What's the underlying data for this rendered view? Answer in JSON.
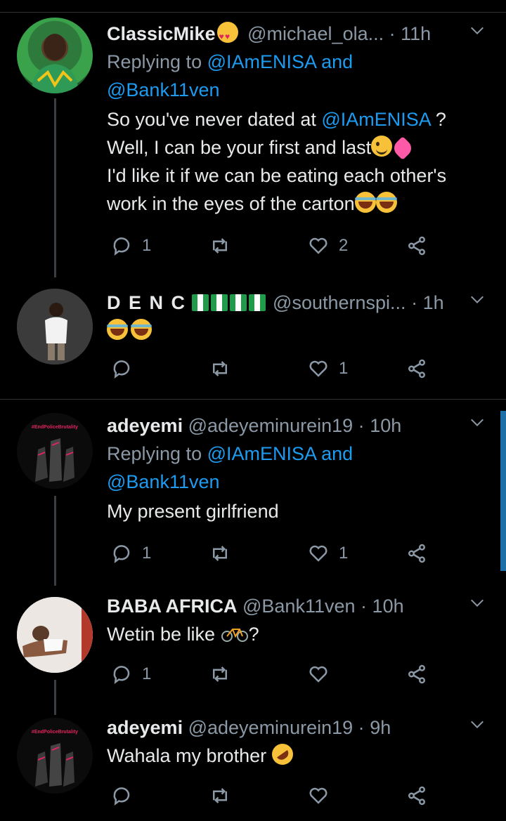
{
  "tweets": [
    {
      "name": "ClassicMike",
      "handle": "@michael_ola...",
      "time": "11h",
      "reply_prefix": "Replying to",
      "reply_users": [
        "@IAmENISA",
        "@Bank11ven"
      ],
      "reply_and": "and",
      "lines": [
        {
          "pre": "So you've never dated at ",
          "mention": "@IAmENISA",
          "post": " ?"
        },
        {
          "pre": "Well, I can be your first and last",
          "mention": "",
          "post": ""
        },
        {
          "pre": "I'd like it if we can be eating each other's",
          "mention": "",
          "post": ""
        },
        {
          "pre": "work in the eyes of the carton",
          "mention": "",
          "post": ""
        }
      ],
      "reply_count": "1",
      "retweet_count": "",
      "like_count": "2"
    },
    {
      "name": "D E N C",
      "handle": "@southernspi...",
      "time": "1h",
      "text": "",
      "reply_count": "",
      "retweet_count": "",
      "like_count": "1"
    },
    {
      "name": "adeyemi",
      "handle": "@adeyeminurein19",
      "time": "10h",
      "reply_prefix": "Replying to",
      "reply_users": [
        "@IAmENISA",
        "@Bank11ven"
      ],
      "reply_and": "and",
      "text": "My present girlfriend",
      "reply_count": "1",
      "retweet_count": "",
      "like_count": "1"
    },
    {
      "name": "BABA AFRICA",
      "handle": "@Bank11ven",
      "time": "10h",
      "text": "Wetin be like",
      "text_post": "?",
      "reply_count": "1",
      "retweet_count": "",
      "like_count": ""
    },
    {
      "name": "adeyemi",
      "handle": "@adeyeminurein19",
      "time": "9h",
      "text": "Wahala my brother",
      "reply_count": "",
      "retweet_count": "",
      "like_count": ""
    }
  ],
  "avatar_badge_text": "#EndPoliceBrutality",
  "colors": {
    "background": "#000000",
    "link": "#1d9bf0",
    "muted": "#8b98a5",
    "text": "#e7e9ea"
  }
}
